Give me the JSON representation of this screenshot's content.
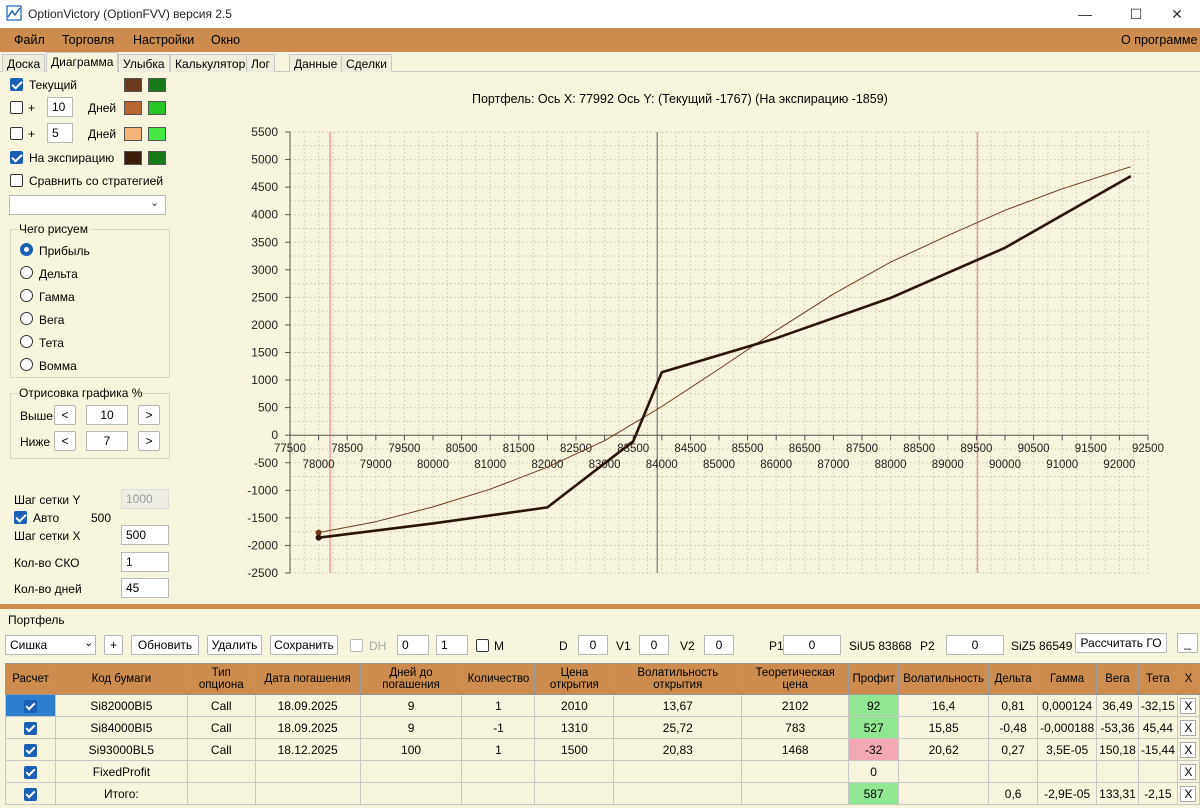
{
  "window": {
    "title": "OptionVictory (OptionFVV) версия 2.5",
    "minimize": "—",
    "maximize": "☐",
    "close": "✕"
  },
  "menu": {
    "items": [
      "Файл",
      "Торговля",
      "Настройки",
      "Окно"
    ],
    "about": "О программе"
  },
  "tabs": [
    "Доска",
    "Диаграмма",
    "Улыбка",
    "Калькулятор",
    "Лог",
    "Данные",
    "Сделки"
  ],
  "left": {
    "current": {
      "label": "Текущий",
      "checked": true,
      "colors": [
        "#6b3a1e",
        "#1a7a1a"
      ]
    },
    "plus10": {
      "plus": "+",
      "value": "10",
      "unit": "Дней",
      "colors": [
        "#b8682e",
        "#29c629"
      ]
    },
    "plus5": {
      "plus": "+",
      "value": "5",
      "unit": "Дней",
      "colors": [
        "#f5b478",
        "#45e845"
      ]
    },
    "expiry": {
      "label": "На экспирацию",
      "colors": [
        "#3a1e0a",
        "#177a17"
      ]
    },
    "compare": {
      "label": "Сравнить со стратегией"
    },
    "what_group": {
      "title": "Чего рисуем",
      "options": [
        "Прибыль",
        "Дельта",
        "Гамма",
        "Вега",
        "Тета",
        "Вомма"
      ],
      "selected": 0
    },
    "draw_group": {
      "title": "Отрисовка графика %",
      "above_label": "Выше",
      "above_value": "10",
      "below_label": "Ниже",
      "below_value": "7",
      "left_btn": "<",
      "right_btn": ">"
    },
    "grid_y_label": "Шаг сетки Y",
    "grid_y_value": "1000",
    "auto_label": "Авто",
    "auto_value": "500",
    "grid_x_label": "Шаг сетки X",
    "grid_x_value": "500",
    "sko_label": "Кол-во СКО",
    "sko_value": "1",
    "days_label": "Кол-во дней",
    "days_value": "45"
  },
  "chart_header": "Портфель:  Ось X:  77992  Ось Y:   (Текущий -1767)   (На экспирацию  -1859)",
  "chart_data": {
    "type": "line",
    "x_range": [
      77500,
      92500
    ],
    "ylim": [
      -2500,
      5500
    ],
    "y_ticks": [
      "5500",
      "5000",
      "4500",
      "4000",
      "3500",
      "3000",
      "2500",
      "2000",
      "1500",
      "1000",
      "500",
      "0",
      "-500",
      "-1000",
      "-1500",
      "-2000",
      "-2500"
    ],
    "x_ticks_upper": [
      "77500",
      "78500",
      "79500",
      "80500",
      "81500",
      "82500",
      "83500",
      "84500",
      "85500",
      "86500",
      "87500",
      "88500",
      "89500",
      "90500",
      "91500",
      "92500"
    ],
    "x_ticks_lower": [
      "78000",
      "79000",
      "80000",
      "81000",
      "82000",
      "83000",
      "84000",
      "85000",
      "86000",
      "87000",
      "88000",
      "89000",
      "90000",
      "91000",
      "92000"
    ],
    "vlines": [
      {
        "x": 78200,
        "color": "#e89aa6"
      },
      {
        "x": 83920,
        "color": "#888888"
      },
      {
        "x": 89520,
        "color": "#e89aa6"
      }
    ],
    "series": [
      {
        "kind": "current",
        "color": "#6b3a1e",
        "x": [
          78000,
          79000,
          80000,
          81000,
          82000,
          83000,
          84000,
          85000,
          86000,
          87000,
          88000,
          89000,
          90000,
          91000,
          92200
        ],
        "y": [
          -1767,
          -1570,
          -1300,
          -980,
          -580,
          -100,
          520,
          1200,
          1900,
          2560,
          3140,
          3620,
          4080,
          4470,
          4870
        ]
      },
      {
        "kind": "expiry",
        "color": "#2a1406",
        "x": [
          78000,
          80000,
          82000,
          83500,
          84000,
          85000,
          86000,
          88000,
          90000,
          92200
        ],
        "y": [
          -1859,
          -1600,
          -1310,
          -110,
          1140,
          1450,
          1760,
          2490,
          3400,
          4700
        ]
      }
    ]
  },
  "portfolio": {
    "title": "Портфель",
    "select_value": "Сишка",
    "plus_btn": "+",
    "refresh_btn": "Обновить",
    "delete_btn": "Удалить",
    "save_btn": "Сохранить",
    "dh_label": "DH",
    "spin1": "0",
    "spin2": "1",
    "m_label": "M",
    "d_label": "D",
    "d_value": "0",
    "v1_label": "V1",
    "v1_value": "0",
    "v2_label": "V2",
    "v2_value": "0",
    "p1_label": "P1",
    "p1_value": "0",
    "si_u5": "SiU5 83868",
    "p2_label": "P2",
    "p2_value": "0",
    "si_z5": "SiZ5 86549",
    "calc_btn": "Рассчитать ГО",
    "minus_btn": "_",
    "columns": [
      "Расчет",
      "Код бумаги",
      "Тип опциона",
      "Дата погашения",
      "Дней до погашения",
      "Количество",
      "Цена открытия",
      "Волатильность открытия",
      "Теоретическая цена",
      "Профит",
      "Волатильность",
      "Дельта",
      "Гамма",
      "Вега",
      "Тета",
      "X"
    ],
    "rows": [
      [
        "",
        "Si82000BI5",
        "Call",
        "18.09.2025",
        "9",
        "1",
        "2010",
        "13,67",
        "2102",
        "92",
        "16,4",
        "0,81",
        "0,000124",
        "36,49",
        "-32,15",
        "X"
      ],
      [
        "",
        "Si84000BI5",
        "Call",
        "18.09.2025",
        "9",
        "-1",
        "1310",
        "25,72",
        "783",
        "527",
        "15,85",
        "-0,48",
        "-0,000188",
        "-53,36",
        "45,44",
        "X"
      ],
      [
        "",
        "Si93000BL5",
        "Call",
        "18.12.2025",
        "100",
        "1",
        "1500",
        "20,83",
        "1468",
        "-32",
        "20,62",
        "0,27",
        "3,5E-05",
        "150,18",
        "-15,44",
        "X"
      ],
      [
        "",
        "FixedProfit",
        "",
        "",
        "",
        "",
        "",
        "",
        "",
        "0",
        "",
        "",
        "",
        "",
        "",
        "X"
      ],
      [
        "",
        "Итого:",
        "",
        "",
        "",
        "",
        "",
        "",
        "",
        "587",
        "",
        "0,6",
        "-2,9E-05",
        "133,31",
        "-2,15",
        "X"
      ]
    ],
    "profit_status": [
      "positive",
      "positive",
      "negative",
      "neutral",
      "positive"
    ]
  }
}
